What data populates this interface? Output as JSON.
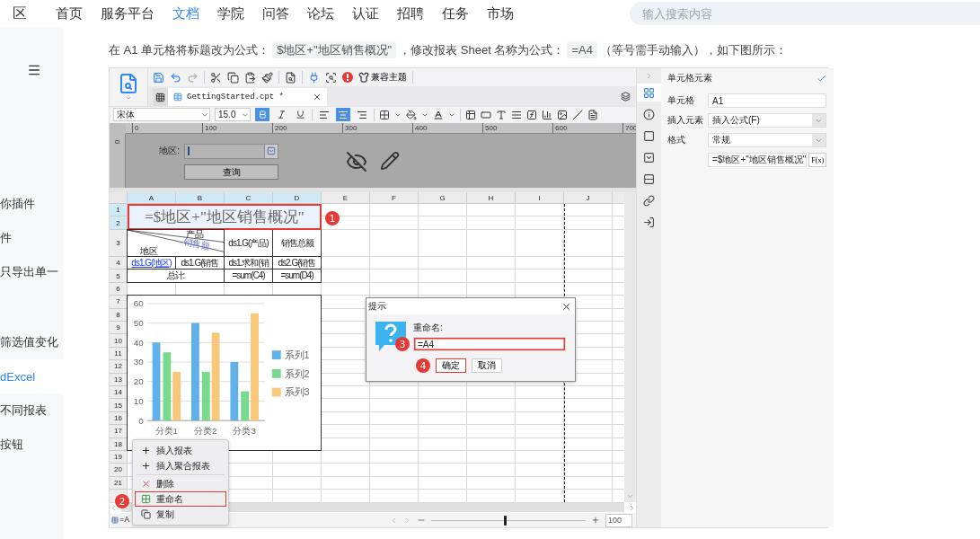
{
  "top_nav": {
    "brand": "区",
    "items": [
      {
        "label": "首页",
        "selected": false
      },
      {
        "label": "服务平台",
        "selected": false
      },
      {
        "label": "文档",
        "selected": true
      },
      {
        "label": "学院",
        "selected": false
      },
      {
        "label": "问答",
        "selected": false
      },
      {
        "label": "论坛",
        "selected": false
      },
      {
        "label": "认证",
        "selected": false
      },
      {
        "label": "招聘",
        "selected": false
      },
      {
        "label": "任务",
        "selected": false
      },
      {
        "label": "市场",
        "selected": false
      }
    ],
    "search": {
      "placeholder": "输入搜索内容"
    }
  },
  "sidebar": {
    "groups": [
      [
        {
          "label": "你插件",
          "selected": false
        },
        {
          "label": "件",
          "selected": false
        },
        {
          "label": "只导出单一",
          "selected": false
        }
      ],
      [
        {
          "label": "筛选值变化",
          "selected": false
        },
        {
          "label": "dExcel",
          "selected": true
        },
        {
          "label": "不同报表",
          "selected": false
        },
        {
          "label": "按钮",
          "selected": false
        }
      ]
    ]
  },
  "intro": [
    {
      "kind": "text",
      "text": "在 A1 单元格将标题改为公式："
    },
    {
      "kind": "code",
      "text": "$地区+\"地区销售概况\""
    },
    {
      "kind": "text",
      "text": "，修改报表 Sheet 名称为公式："
    },
    {
      "kind": "code",
      "text": "=A4"
    },
    {
      "kind": "text",
      "text": "（等号需手动输入），如下图所示："
    }
  ],
  "designer": {
    "theme_button": "兼容主题",
    "tab": {
      "label": "GettingStarted.cpt *"
    },
    "format_bar": {
      "font": "宋体",
      "size": "15.0",
      "styles": [
        {
          "kind": "bold",
          "selected": true
        },
        {
          "kind": "italic",
          "selected": false
        },
        {
          "kind": "underline",
          "selected": false
        }
      ],
      "alignments": [
        {
          "kind": "left",
          "selected": false
        },
        {
          "kind": "center",
          "selected": true
        },
        {
          "kind": "right",
          "selected": false
        }
      ]
    },
    "parameter_pane": {
      "ruler": [
        "0",
        "100",
        "200",
        "300",
        "400",
        "500",
        "600",
        "700"
      ],
      "vertical_ruler": "0",
      "label": "地区:",
      "button": "查询"
    },
    "sheet": {
      "columns": [
        {
          "label": "A",
          "selected": true
        },
        {
          "label": "B",
          "selected": true
        },
        {
          "label": "C",
          "selected": true
        },
        {
          "label": "D",
          "selected": true
        },
        {
          "label": "E",
          "selected": false
        },
        {
          "label": "F",
          "selected": false
        },
        {
          "label": "G",
          "selected": false
        },
        {
          "label": "H",
          "selected": false
        },
        {
          "label": "I",
          "selected": false
        },
        {
          "label": "J",
          "selected": false
        }
      ],
      "rows": [
        {
          "label": "1",
          "selected": true
        },
        {
          "label": "2",
          "selected": true
        },
        {
          "label": "3",
          "selected": false
        },
        {
          "label": "4",
          "selected": false
        },
        {
          "label": "5",
          "selected": false
        },
        {
          "label": "6",
          "selected": false
        },
        {
          "label": "7",
          "selected": false
        },
        {
          "label": "8",
          "selected": false
        },
        {
          "label": "9",
          "selected": false
        },
        {
          "label": "10",
          "selected": false
        },
        {
          "label": "11",
          "selected": false
        },
        {
          "label": "12",
          "selected": false
        },
        {
          "label": "13",
          "selected": false
        },
        {
          "label": "14",
          "selected": false
        },
        {
          "label": "15",
          "selected": false
        },
        {
          "label": "16",
          "selected": false
        },
        {
          "label": "17",
          "selected": false
        },
        {
          "label": "18",
          "selected": false
        },
        {
          "label": "19",
          "selected": false
        },
        {
          "label": "20",
          "selected": false
        },
        {
          "label": "21",
          "selected": false
        }
      ],
      "cells": [
        {
          "kind": "title",
          "text": "=$地区+\"地区销售概况\"",
          "callout": "1"
        },
        {
          "kind": "diagonal",
          "labels": [
            "产品",
            "销售额",
            "地区"
          ]
        },
        {
          "kind": "text",
          "text": "ds1.G(产品)"
        },
        {
          "kind": "text",
          "text": "销售总额"
        },
        {
          "kind": "link",
          "text": "ds1.G(地区)"
        },
        {
          "kind": "text",
          "text": "ds1.G(销售"
        },
        {
          "kind": "text",
          "text": "ds1.求和(销"
        },
        {
          "kind": "text",
          "text": "ds2.G(销售"
        },
        {
          "kind": "text",
          "text": "总计:"
        },
        {
          "kind": "text",
          "text": "=sum(C4)"
        },
        {
          "kind": "text",
          "text": "=sum(D4)"
        }
      ],
      "chart_data": {
        "type": "bar",
        "grid": true,
        "legend": "right",
        "categories": [
          "分类1",
          "分类2",
          "分类3"
        ],
        "ylim": [
          0,
          60
        ],
        "yticks": [
          0,
          10,
          20,
          30,
          40,
          50,
          60
        ],
        "series": [
          {
            "name": "系列1",
            "color": "#62b0e8",
            "values": [
              40,
              50,
              30
            ]
          },
          {
            "name": "系列2",
            "color": "#78d98f",
            "values": [
              35,
              25,
              15
            ]
          },
          {
            "name": "系列3",
            "color": "#f8c87a",
            "values": [
              25,
              45,
              55
            ]
          }
        ]
      }
    },
    "context_menu": {
      "items": [
        {
          "kind": "add",
          "label": "插入报表",
          "selected": false
        },
        {
          "kind": "add",
          "label": "插入聚合报表",
          "selected": false
        },
        {
          "kind": "delete",
          "label": "删除",
          "selected": false
        },
        {
          "kind": "rename",
          "label": "重命名",
          "selected": true,
          "callout": "2"
        },
        {
          "kind": "copy",
          "label": "复制",
          "selected": false
        }
      ]
    },
    "dialog": {
      "title": "提示",
      "label": "重命名:",
      "value": "=A4",
      "callout": "3",
      "buttons": [
        {
          "label": "确定",
          "callout": "4"
        },
        {
          "label": "取消"
        }
      ]
    },
    "side_tabs": [
      {
        "kind": "cell",
        "selected": true
      },
      {
        "kind": "attributes",
        "selected": false
      },
      {
        "kind": "border",
        "selected": false
      },
      {
        "kind": "widget",
        "selected": false
      },
      {
        "kind": "condition",
        "selected": false
      },
      {
        "kind": "link",
        "selected": false
      },
      {
        "kind": "import",
        "selected": false
      }
    ],
    "properties": {
      "title": "单元格元素",
      "fields": [
        {
          "kind": "input",
          "label": "单元格",
          "value": "A1"
        },
        {
          "kind": "select",
          "label": "插入元素",
          "value": "插入公式(F)"
        },
        {
          "kind": "select",
          "label": "格式",
          "value": "常规"
        },
        {
          "kind": "formula",
          "value": "=$地区+\"地区销售概况\"",
          "button": "F(x)"
        }
      ]
    },
    "status_bar": {
      "sheet_tab": "=A",
      "zoom": {
        "level": 0.47,
        "value": "100"
      }
    }
  }
}
